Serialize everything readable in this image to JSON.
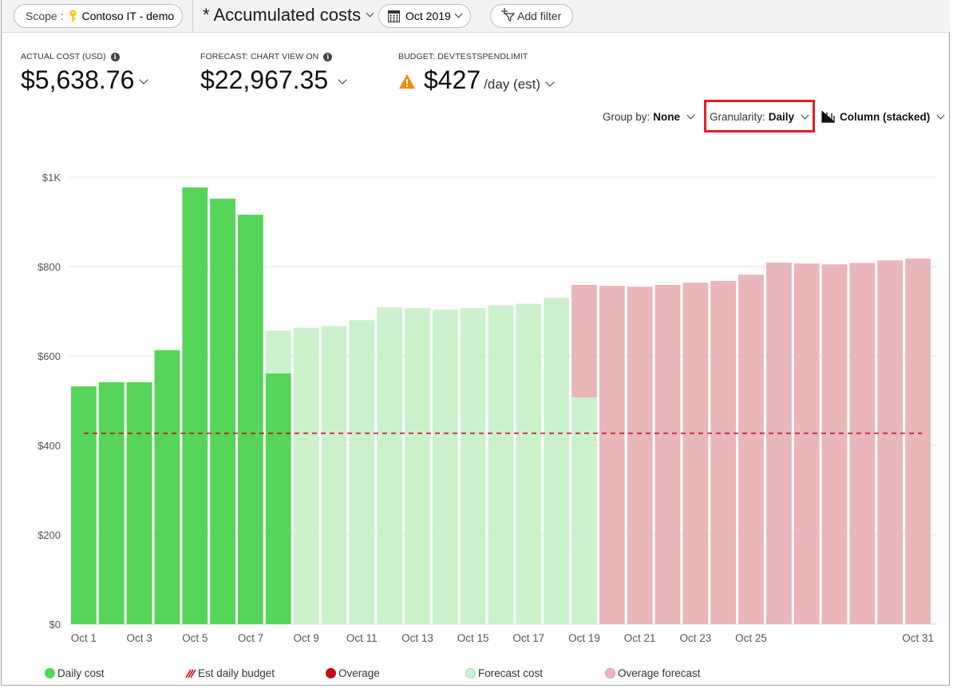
{
  "toolbar": {
    "scope_label": "Scope :",
    "scope_value": "Contoso IT - demo",
    "view_title": "* Accumulated costs",
    "date_range": "Oct 2019",
    "add_filter": "Add filter"
  },
  "kpis": {
    "actual": {
      "caption": "ACTUAL COST (USD)",
      "value": "$5,638.76"
    },
    "forecast": {
      "caption": "FORECAST: CHART VIEW ON",
      "value": "$22,967.35"
    },
    "budget": {
      "caption": "BUDGET: DEVTESTSPENDLIMIT",
      "value": "$427",
      "unit": "/day (est)"
    }
  },
  "controls": {
    "group_by_label": "Group by:",
    "group_by_value": "None",
    "granularity_label": "Granularity:",
    "granularity_value": "Daily",
    "chart_type": "Column (stacked)"
  },
  "colors": {
    "daily_cost": "#57d45a",
    "forecast": "#cdf1cd",
    "overage": "#c00d16",
    "overage_forecast": "#e9b6ba",
    "budget_line": "#c00d16",
    "highlight": "#e51f26",
    "warning": "#f58a07"
  },
  "chart_data": {
    "type": "bar",
    "stacked": true,
    "title": "",
    "xlabel": "",
    "ylabel": "",
    "ylim": [
      0,
      1000
    ],
    "y_ticks": [
      "$0",
      "$200",
      "$400",
      "$600",
      "$800",
      "$1K"
    ],
    "y_tick_values": [
      0,
      200,
      400,
      600,
      800,
      1000
    ],
    "grid": true,
    "legend_position": "bottom",
    "categories": [
      "Oct 1",
      "Oct 2",
      "Oct 3",
      "Oct 4",
      "Oct 5",
      "Oct 6",
      "Oct 7",
      "Oct 8",
      "Oct 9",
      "Oct 10",
      "Oct 11",
      "Oct 12",
      "Oct 13",
      "Oct 14",
      "Oct 15",
      "Oct 16",
      "Oct 17",
      "Oct 18",
      "Oct 19",
      "Oct 20",
      "Oct 21",
      "Oct 22",
      "Oct 23",
      "Oct 24",
      "Oct 25",
      "Oct 26",
      "Oct 27",
      "Oct 28",
      "Oct 29",
      "Oct 30",
      "Oct 31"
    ],
    "x_tick_labels": [
      "Oct 1",
      "",
      "Oct 3",
      "",
      "Oct 5",
      "",
      "Oct 7",
      "",
      "Oct 9",
      "",
      "Oct 11",
      "",
      "Oct 13",
      "",
      "Oct 15",
      "",
      "Oct 17",
      "",
      "Oct 19",
      "",
      "Oct 21",
      "",
      "Oct 23",
      "",
      "Oct 25",
      "",
      "",
      "",
      "",
      "",
      "Oct 31"
    ],
    "series": [
      {
        "name": "Daily cost",
        "color_key": "daily_cost",
        "values": [
          532,
          541,
          541,
          613,
          977,
          952,
          916,
          561,
          0,
          0,
          0,
          0,
          0,
          0,
          0,
          0,
          0,
          0,
          0,
          0,
          0,
          0,
          0,
          0,
          0,
          0,
          0,
          0,
          0,
          0,
          0
        ]
      },
      {
        "name": "Forecast cost",
        "color_key": "forecast",
        "values": [
          0,
          0,
          0,
          0,
          0,
          0,
          0,
          96,
          663,
          667,
          680,
          709,
          707,
          704,
          707,
          713,
          717,
          730,
          507,
          0,
          0,
          0,
          0,
          0,
          0,
          0,
          0,
          0,
          0,
          0,
          0
        ]
      },
      {
        "name": "Overage forecast",
        "color_key": "overage_forecast",
        "values": [
          0,
          0,
          0,
          0,
          0,
          0,
          0,
          0,
          0,
          0,
          0,
          0,
          0,
          0,
          0,
          0,
          0,
          0,
          252,
          757,
          755,
          759,
          764,
          768,
          782,
          809,
          807,
          805,
          808,
          814,
          818
        ]
      }
    ],
    "reference_line": {
      "name": "Est daily budget",
      "value": 427
    },
    "legend": [
      {
        "label": "Daily cost",
        "marker": "dot",
        "color_key": "daily_cost"
      },
      {
        "label": "Est daily budget",
        "marker": "hatch",
        "color_key": "budget_line"
      },
      {
        "label": "Overage",
        "marker": "dot",
        "color_key": "overage"
      },
      {
        "label": "Forecast cost",
        "marker": "dot",
        "color_key": "forecast"
      },
      {
        "label": "Overage forecast",
        "marker": "dot",
        "color_key": "overage_forecast"
      }
    ]
  }
}
